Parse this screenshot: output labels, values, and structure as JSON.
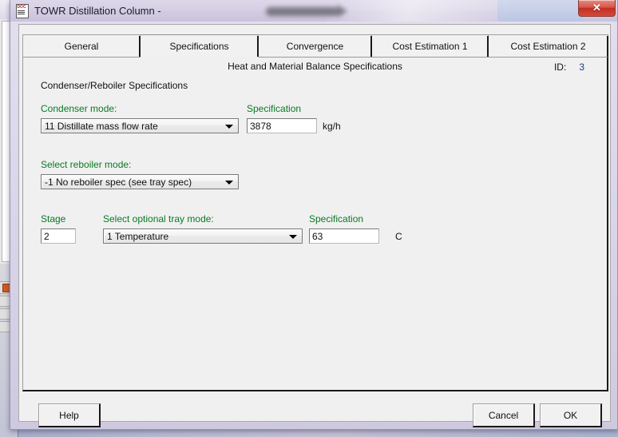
{
  "window": {
    "title": "TOWR Distillation Column -",
    "icon": "document-icon",
    "doc_icon_label": "DOC",
    "close_label": "✕",
    "title_redacted": true
  },
  "tabs": [
    {
      "label": "General",
      "selected": false
    },
    {
      "label": "Specifications",
      "selected": true
    },
    {
      "label": "Convergence",
      "selected": false
    },
    {
      "label": "Cost Estimation 1",
      "selected": false
    },
    {
      "label": "Cost Estimation 2",
      "selected": false
    }
  ],
  "page": {
    "heading": "Heat and Material Balance Specifications",
    "id_label": "ID:",
    "id_value": "3",
    "section_title": "Condenser/Reboiler Specifications",
    "condenser": {
      "mode_label": "Condenser mode:",
      "mode_value": "11 Distillate mass flow rate",
      "spec_label": "Specification",
      "spec_value": "3878",
      "spec_unit": "kg/h"
    },
    "reboiler": {
      "mode_label": "Select reboiler mode:",
      "mode_value": "-1 No reboiler spec (see tray spec)"
    },
    "tray": {
      "stage_label": "Stage",
      "stage_value": "2",
      "mode_label": "Select optional tray mode:",
      "mode_value": "1 Temperature",
      "spec_label": "Specification",
      "spec_value": "63",
      "spec_unit": "C"
    }
  },
  "buttons": {
    "help": "Help",
    "cancel": "Cancel",
    "ok": "OK"
  },
  "colors": {
    "label_green": "#0a7a22",
    "id_value_blue": "#1b3f73",
    "close_red": "#c32f22",
    "panel_gray": "#f0f0f0",
    "window_chrome": "#d6cfe4"
  }
}
